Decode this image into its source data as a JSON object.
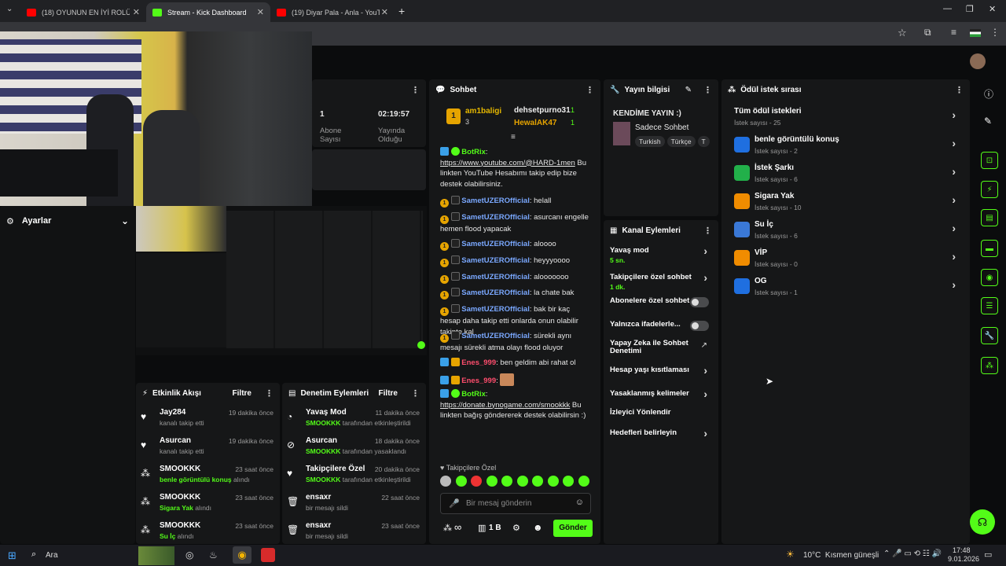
{
  "browser": {
    "tabs": [
      {
        "label": "(18) OYUNUN EN İYİ ROLÜ!! BO",
        "icon_color": "#ff0000",
        "active": false
      },
      {
        "label": "Stream - Kick Dashboard",
        "icon_color": "#53fc18",
        "active": true
      },
      {
        "label": "(19) Diyar Pala - Anla - YouTube",
        "icon_color": "#ff0000",
        "active": false
      }
    ],
    "new_tab": "+"
  },
  "stats": {
    "subs_value": "1",
    "subs_label": "Abone Sayısı",
    "uptime_value": "02:19:57",
    "uptime_label": "Yayında Olduğu"
  },
  "settings": {
    "label": "Ayarlar"
  },
  "chat": {
    "title": "Sohbet",
    "leaderboard": [
      {
        "name": "am1baligi",
        "count": "3"
      },
      {
        "name": "dehsetpurno31",
        "count": "1"
      },
      {
        "name": "HewalAK47",
        "count": "1"
      }
    ],
    "leader_rank": "1",
    "messages": [
      {
        "user": "BotRix",
        "kind": "bot",
        "text": "",
        "link": "https://www.youtube.com/@HARD-1men",
        "after": " Bu linkten YouTube Hesabımı takip edip bize destek olabilirsiniz."
      },
      {
        "user": "SametUZEROfficial",
        "kind": "user",
        "text": "helall"
      },
      {
        "user": "SametUZEROfficial",
        "kind": "user",
        "text": "asurcanı engelle hemen flood yapacak"
      },
      {
        "user": "SametUZEROfficial",
        "kind": "user",
        "text": "aloooo"
      },
      {
        "user": "SametUZEROfficial",
        "kind": "user",
        "text": "heyyyoooo"
      },
      {
        "user": "SametUZEROfficial",
        "kind": "user",
        "text": "alooooooo"
      },
      {
        "user": "SametUZEROfficial",
        "kind": "user",
        "text": "la chate bak"
      },
      {
        "user": "SametUZEROfficial",
        "kind": "user",
        "text": "bak bir kaç hesap daha takip etti onlarda onun olabilir takipte kal"
      },
      {
        "user": "SametUZEROfficial",
        "kind": "user",
        "text": "sürekli aynı mesajı sürekli atma olayı flood oluyor"
      },
      {
        "user": "Enes_999",
        "kind": "red",
        "text": "ben geldim abi rahat ol"
      },
      {
        "user": "Enes_999",
        "kind": "red",
        "text": ""
      },
      {
        "user": "BotRix",
        "kind": "bot",
        "text": "",
        "link": "https://donate.bynogame.com/smookkk",
        "after": " Bu linkten bağış göndererek destek olabilirsin :)"
      }
    ],
    "followers_only": "Takipçilere Özel",
    "input_placeholder": "Bir mesaj gönderin",
    "footer_count": "1 B",
    "send_label": "Gönder",
    "infinity": "∞"
  },
  "stream_info": {
    "title": "Yayın bilgisi",
    "stream_title": "KENDİME YAYIN :)",
    "category": "Sadece Sohbet",
    "tags": [
      "Turkish",
      "Türkçe",
      "T"
    ]
  },
  "channel_actions": {
    "title": "Kanal Eylemleri",
    "items": [
      {
        "label": "Yavaş mod",
        "sub": "5 sn.",
        "control": "chevron"
      },
      {
        "label": "Takipçilere özel sohbet",
        "sub": "1 dk.",
        "control": "chevron"
      },
      {
        "label": "Abonelere özel sohbet",
        "sub": "",
        "control": "toggle"
      },
      {
        "label": "Yalnızca ifadelerle...",
        "sub": "",
        "control": "toggle"
      },
      {
        "label": "Yapay Zeka ile Sohbet Denetimi",
        "sub": "",
        "control": "external"
      },
      {
        "label": "Hesap yaşı kısıtlaması",
        "sub": "",
        "control": "chevron"
      },
      {
        "label": "Yasaklanmış kelimeler",
        "sub": "",
        "control": "chevron"
      },
      {
        "label": "İzleyici Yönlendir",
        "sub": "",
        "control": "none"
      },
      {
        "label": "Hedefleri belirleyin",
        "sub": "",
        "control": "chevron"
      }
    ]
  },
  "rewards": {
    "title": "Ödül istek sırası",
    "all_label": "Tüm ödül istekleri",
    "all_count": "İstek sayısı - 25",
    "items": [
      {
        "label": "benle görüntülü konuş",
        "count": "İstek sayısı - 2",
        "color": "#1f6fe0"
      },
      {
        "label": "İstek Şarkı",
        "count": "İstek sayısı - 6",
        "color": "#22b04a"
      },
      {
        "label": "Sigara Yak",
        "count": "İstek sayısı - 10",
        "color": "#f08c00"
      },
      {
        "label": "Su İç",
        "count": "İstek sayısı - 6",
        "color": "#3a78d6"
      },
      {
        "label": "VİP",
        "count": "İstek sayısı - 0",
        "color": "#f08c00"
      },
      {
        "label": "OG",
        "count": "İstek sayısı - 1",
        "color": "#1f6fe0"
      }
    ]
  },
  "activity": {
    "title": "Etkinlik Akışı",
    "filter": "Filtre",
    "items": [
      {
        "icon": "heart",
        "user": "Jay284",
        "action": "kanalı takip etti",
        "time": "19 dakika önce"
      },
      {
        "icon": "heart",
        "user": "Asurcan",
        "action": "kanalı takip etti",
        "time": "19 dakika önce"
      },
      {
        "icon": "reward",
        "user": "SMOOKKK",
        "highlight": "benle görüntülü konuş",
        "action": " alındı",
        "time": "23 saat önce"
      },
      {
        "icon": "reward",
        "user": "SMOOKKK",
        "highlight": "Sigara Yak",
        "action": " alındı",
        "time": "23 saat önce"
      },
      {
        "icon": "reward",
        "user": "SMOOKKK",
        "highlight": "Su İç",
        "action": " alındı",
        "time": "23 saat önce"
      }
    ]
  },
  "moderation": {
    "title": "Denetim Eylemleri",
    "filter": "Filtre",
    "items": [
      {
        "icon": "snail",
        "title": "Yavaş Mod",
        "who": "SMOOKKK",
        "action": " tarafından etkinleştirildi",
        "time": "11 dakika önce"
      },
      {
        "icon": "ban",
        "title": "Asurcan",
        "who": "SMOOKKK",
        "action": " tarafından yasaklandı",
        "time": "18 dakika önce"
      },
      {
        "icon": "heart",
        "title": "Takipçilere Özel",
        "who": "SMOOKKK",
        "action": " tarafından etkinleştirildi",
        "time": "20 dakika önce"
      },
      {
        "icon": "trash",
        "title": "ensaxr",
        "who": "",
        "action": "bir mesajı sildi",
        "time": "22 saat önce"
      },
      {
        "icon": "trash",
        "title": "ensaxr",
        "who": "",
        "action": "bir mesajı sildi",
        "time": "23 saat önce"
      }
    ]
  },
  "taskbar": {
    "search": "Ara",
    "weather": "10°C  Kısmen güneşli",
    "time": "17:48",
    "date": "9.01.2026"
  }
}
